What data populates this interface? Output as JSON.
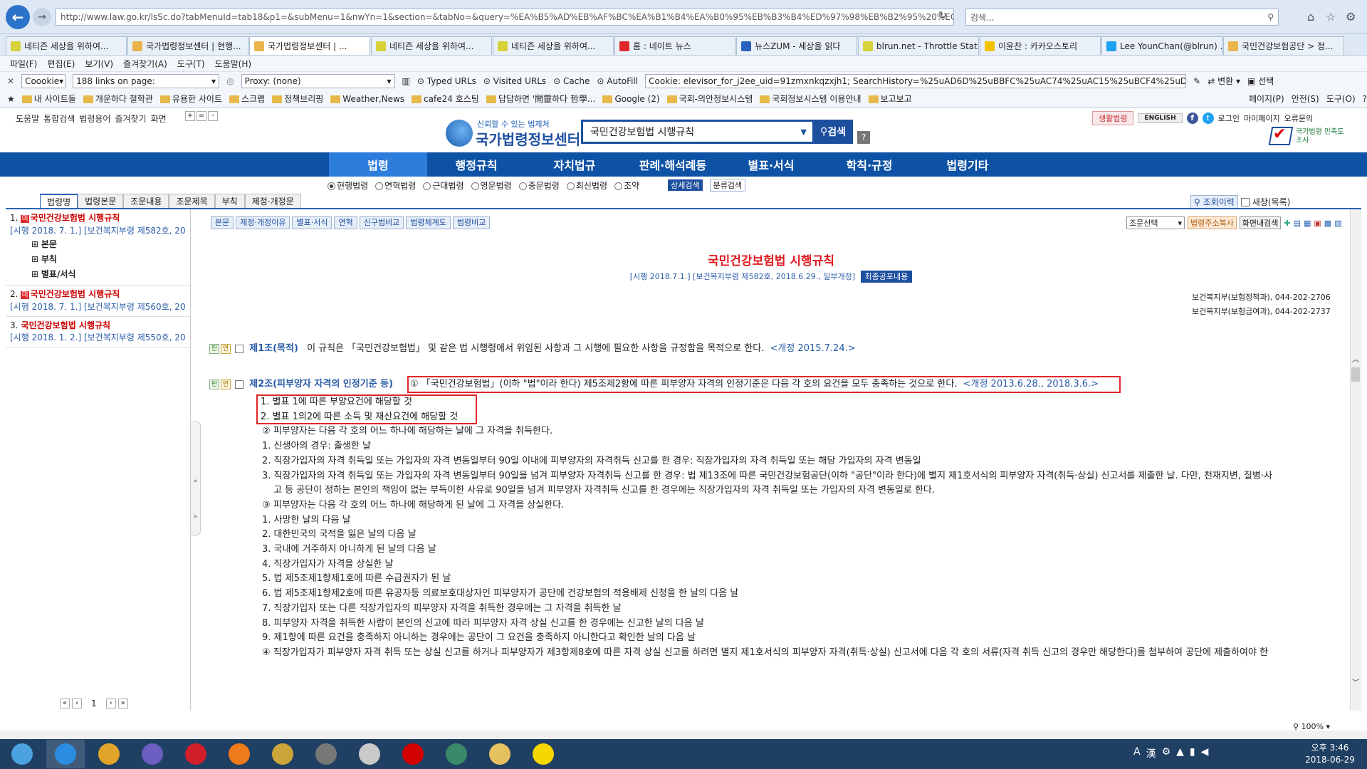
{
  "browser": {
    "url": "http://www.law.go.kr/lsSc.do?tabMenuId=tab18&p1=&subMenu=1&nwYn=1&section=&tabNo=&query=%EA%B5%AD%EB%AF%BC%EA%B1%B4%EA%B0%95%EB%B3%B4%ED%97%98%EB%B2%95%20%EC%8B%9C%EC",
    "search_placeholder": "검색...",
    "tabs": [
      {
        "label": "네티즌 세상을 위하여...",
        "color": "#d7d23a"
      },
      {
        "label": "국가법령정보센터 | 현행...",
        "color": "#e9b44c"
      },
      {
        "label": "국가법령정보센터 | ...",
        "color": "#e9b44c"
      },
      {
        "label": "네티즌 세상을 위하여...",
        "color": "#d7d23a"
      },
      {
        "label": "네티즌 세상을 위하여...",
        "color": "#d7d23a"
      },
      {
        "label": "홈 : 네이트 뉴스",
        "color": "#e0262a"
      },
      {
        "label": "뉴스ZUM - 세상을 읽다",
        "color": "#2b5fc0"
      },
      {
        "label": "blrun.net - Throttle Status",
        "color": "#d7d23a"
      },
      {
        "label": "이윤찬 : 카카오스토리",
        "color": "#f3c200"
      },
      {
        "label": "Lee YounChan(@blrun) ...",
        "color": "#1da1f2"
      },
      {
        "label": "국민건강보험공단 > 정...",
        "color": "#e9b44c"
      }
    ],
    "menu": [
      "파일(F)",
      "편집(E)",
      "보기(V)",
      "즐겨찾기(A)",
      "도구(T)",
      "도움말(H)"
    ],
    "toolbar1": {
      "coookie": "Coookie",
      "links": "188 links on page:",
      "proxy": "Proxy: (none)",
      "typed_urls": "Typed URLs",
      "visited_urls": "Visited URLs",
      "cache": "Cache",
      "autofill": "AutoFill",
      "cookie_value": "Cookie: elevisor_for_j2ee_uid=91zmxnkqzxjh1; SearchHistory=%25uAD6D%25uBBFC%25uAC74%25uAC15%25uBCF4%25uD5D8%25uB",
      "convert": "변환",
      "select": "선택"
    },
    "favorites": [
      "내 사이트들",
      "개운하다 철학관",
      "유용한 사이트",
      "스크랩",
      "정책브리핑",
      "Weather,News",
      "cafe24 호스팅",
      "답답하면 '開靈하다 哲學...",
      "Google (2)",
      "국회-의안정보시스템",
      "국회정보시스템 이용안내",
      "보고보고"
    ],
    "favorites_tools": [
      "페이지(P)",
      "안전(S)",
      "도구(O)"
    ]
  },
  "site": {
    "util_links": [
      "도움말",
      "통합검색",
      "법령용어",
      "즐겨찾기",
      "화면"
    ],
    "font_controls": [
      "+",
      "=",
      "-"
    ],
    "logo_slogan": "신뢰할 수 있는 법제처",
    "logo_name": "국가법령정보센터",
    "search_value": "국민건강보험법 시행규칙",
    "search_button": "검색",
    "help": "?",
    "right_links": {
      "life": "생활법령",
      "english": "ENGLISH",
      "login": "로그인",
      "mypage": "마이페이지",
      "report": "오류문의"
    },
    "banner_text": "국가법령 만족도 조사",
    "gnb": [
      "법령",
      "행정규칙",
      "자치법규",
      "판례·해석례등",
      "별표·서식",
      "학칙·규정",
      "법령기타"
    ],
    "search_options": [
      "현행법령",
      "연혁법령",
      "근대법령",
      "영문법령",
      "중문법령",
      "최신법령",
      "조약"
    ],
    "detail_search": "상세검색",
    "category_search": "분류검색",
    "left_tabs": [
      "법령명",
      "법령본문",
      "조문내용",
      "조문제목",
      "부칙",
      "제정·개정문"
    ],
    "history_btn": "조회이력",
    "new_window": "새창(목록)",
    "results": [
      {
        "num": "1.",
        "badge": "미",
        "title": "국민건강보험법 시행규칙",
        "sub": "[시행 2018. 7. 1.] [보건복지부령 제582호, 2018."
      },
      {
        "num": "2.",
        "badge": "미",
        "title": "국민건강보험법 시행규칙",
        "sub": "[시행 2018. 7. 1.] [보건복지부령 제560호, 2018."
      },
      {
        "num": "3.",
        "badge": "",
        "title": "국민건강보험법 시행규칙",
        "sub": "[시행 2018. 1. 2.] [보건복지부령 제550호, 2017."
      }
    ],
    "tree": [
      "본문",
      "부칙",
      "별표/서식"
    ],
    "pagination": {
      "first": "«",
      "prev": "‹",
      "page": "1",
      "next": "›",
      "last": "»"
    },
    "content_buttons": [
      "본문",
      "제정·개정이유",
      "별표·서식",
      "연혁",
      "신구법비교",
      "법령체계도",
      "법령비교"
    ],
    "article_select": "조문선택",
    "address_print": "법령주소복사",
    "screen_search": "화면내검색",
    "law_title": "국민건강보험법 시행규칙",
    "law_sub": "[시행 2018.7.1.] [보건복지부령 제582호, 2018.6.29., 일부개정]",
    "latest_btn": "최종공포내용",
    "dept": [
      "보건복지부(보험정책과), 044-202-2706",
      "보건복지부(보험급여과), 044-202-2737"
    ],
    "articles": {
      "a1_title": "제1조(목적)",
      "a1_text": "이 규칙은 「국민건강보험법」 및 같은 법 시행령에서 위임된 사항과 그 시행에 필요한 사항을 규정함을 목적으로 한다.",
      "a1_rev": "<개정 2015.7.24.>",
      "a2_title": "제2조(피부양자 자격의 인정기준 등)",
      "a2_p1": "① 「국민건강보험법」(이하 \"법\"이라 한다) 제5조제2항에 따른 피부양자 자격의 인정기준은 다음 각 호의 요건을 모두 충족하는 것으로 한다.",
      "a2_p1_rev": "<개정 2013.6.28., 2018.3.6.>",
      "lines": [
        "1. 별표 1에 따른 부양요건에 해당할 것",
        "2. 별표 1의2에 따른 소득 및 재산요건에 해당할 것",
        "② 피부양자는 다음 각 호의 어느 하나에 해당하는 날에 그 자격을 취득한다.",
        "1. 신생아의 경우: 출생한 날",
        "2. 직장가입자의 자격 취득일 또는 가입자의 자격 변동일부터 90일 이내에 피부양자의 자격취득 신고를 한 경우: 직장가입자의 자격 취득일 또는 해당 가입자의 자격 변동일",
        "3. 직장가입자의 자격 취득일 또는 가입자의 자격 변동일부터 90일을 넘겨 피부양자 자격취득 신고를 한 경우: 법 제13조에 따른 국민건강보험공단(이하 \"공단\"이라 한다)에 별지 제1호서식의 피부양자 자격(취득·상실) 신고서를 제출한 날. 다만, 천재지변, 질병·사",
        "고 등 공단이 정하는 본인의 책임이 없는 부득이한 사유로 90일을 넘겨 피부양자 자격취득 신고를 한 경우에는 직장가입자의 자격 취득일 또는 가입자의 자격 변동일로 한다.",
        "③ 피부양자는 다음 각 호의 어느 하나에 해당하게 된 날에 그 자격을 상실한다.",
        "1. 사망한 날의 다음 날",
        "2. 대한민국의 국적을 잃은 날의 다음 날",
        "3. 국내에 거주하지 아니하게 된 날의 다음 날",
        "4. 직장가입자가 자격을 상실한 날",
        "5. 법 제5조제1항제1호에 따른 수급권자가 된 날",
        "6. 법 제5조제1항제2호에 따른 유공자등 의료보호대상자인 피부양자가 공단에 건강보험의 적용배제 신청을 한 날의 다음 날",
        "7. 직장가입자 또는 다른 직장가입자의 피부양자 자격을 취득한 경우에는 그 자격을 취득한 날",
        "8. 피부양자 자격을 취득한 사람이 본인의 신고에 따라 피부양자 자격 상실 신고를 한 경우에는 신고한 날의 다음 날",
        "9. 제1항에 따른 요건을 충족하지 아니하는 경우에는 공단이 그 요건을 충족하지 아니한다고 확인한 날의 다음 날",
        "④ 직장가입자가 피부양자 자격 취득 또는 상실 신고를 하거나 피부양자가 제3항제8호에 따른 자격 상실 신고를 하려면 별지 제1호서식의 피부양자 자격(취득·상실) 신고서에 다음 각 호의 서류(자격 취득 신고의 경우만 해당한다)를 첨부하여 공단에 제출하여야 한"
      ]
    }
  },
  "status": {
    "zoom": "100%"
  },
  "clock": {
    "ampm_time": "오후 3:46",
    "date": "2018-06-29"
  },
  "taskbar_icons": [
    {
      "name": "start",
      "color": "#4aa3e0"
    },
    {
      "name": "ie",
      "color": "#2b8ce0"
    },
    {
      "name": "chrome",
      "color": "#e0a52a"
    },
    {
      "name": "app-s",
      "color": "#6a5ec0"
    },
    {
      "name": "opera",
      "color": "#d01f2a"
    },
    {
      "name": "firefox",
      "color": "#ef7a1a"
    },
    {
      "name": "pen",
      "color": "#caa63a"
    },
    {
      "name": "book",
      "color": "#777777"
    },
    {
      "name": "media",
      "color": "#c9c9c9"
    },
    {
      "name": "record",
      "color": "#d40000"
    },
    {
      "name": "tree",
      "color": "#3a8a6a"
    },
    {
      "name": "folder",
      "color": "#e6c160"
    },
    {
      "name": "kakaotalk",
      "color": "#f7d700"
    }
  ]
}
